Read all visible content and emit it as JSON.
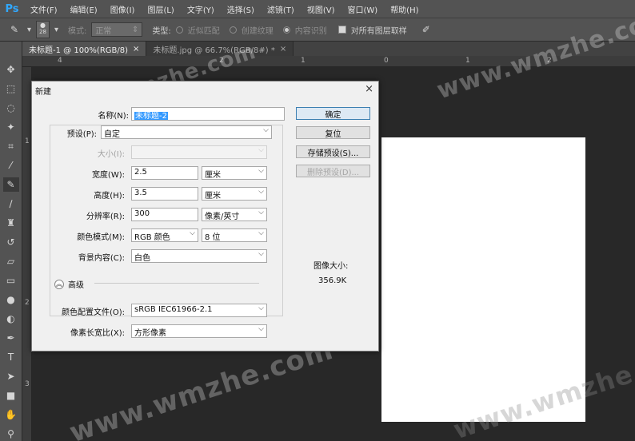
{
  "app": {
    "logo": "Ps",
    "menu": [
      "文件(F)",
      "编辑(E)",
      "图像(I)",
      "图层(L)",
      "文字(Y)",
      "选择(S)",
      "滤镜(T)",
      "视图(V)",
      "窗口(W)",
      "帮助(H)"
    ]
  },
  "options": {
    "brush_size": "28",
    "mode_label": "模式:",
    "mode_value": "正常",
    "type_label": "类型:",
    "type_opt1": "近似匹配",
    "type_opt2": "创建纹理",
    "type_opt3": "内容识别",
    "sample_all": "对所有图层取样"
  },
  "tabs": [
    {
      "label": "未标题-1 @ 100%(RGB/8)",
      "close": "×"
    },
    {
      "label": "未标题.jpg @ 66.7%(RGB/8#) *",
      "close": "×"
    }
  ],
  "ruler": {
    "h": [
      "4",
      "2",
      "1",
      "0",
      "1",
      "2"
    ],
    "v": [
      "1",
      "2",
      "3"
    ]
  },
  "dialog": {
    "title": "新建",
    "close": "×",
    "name_label": "名称(N):",
    "name_value": "未标题-2",
    "preset_label": "预设(P):",
    "preset_value": "自定",
    "size_label": "大小(I):",
    "width_label": "宽度(W):",
    "width_value": "2.5",
    "width_unit": "厘米",
    "height_label": "高度(H):",
    "height_value": "3.5",
    "height_unit": "厘米",
    "resolution_label": "分辨率(R):",
    "resolution_value": "300",
    "resolution_unit": "像素/英寸",
    "colormode_label": "颜色模式(M):",
    "colormode_value": "RGB 颜色",
    "bitdepth_value": "8 位",
    "bg_label": "背景内容(C):",
    "bg_value": "白色",
    "advanced_label": "高级",
    "profile_label": "颜色配置文件(O):",
    "profile_value": "sRGB IEC61966-2.1",
    "aspect_label": "像素长宽比(X):",
    "aspect_value": "方形像素",
    "ok": "确定",
    "reset": "复位",
    "save_preset": "存储预设(S)...",
    "delete_preset": "删除预设(D)...",
    "image_size_label": "图像大小:",
    "image_size_value": "356.9K"
  },
  "watermark": "www.wmzhe.com",
  "colors": {
    "accent": "#31a8ff",
    "selection": "#3399ff"
  }
}
